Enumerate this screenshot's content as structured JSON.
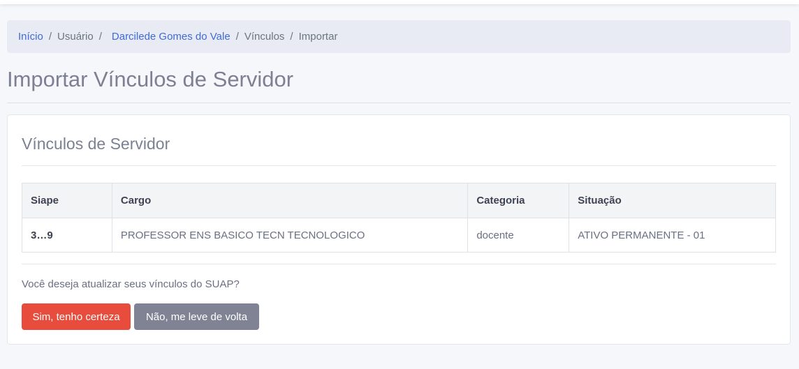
{
  "breadcrumb": {
    "home": "Início",
    "user": "Usuário",
    "person": "Darcilede Gomes do Vale",
    "links": "Vínculos",
    "current": "Importar",
    "separator": "/"
  },
  "page": {
    "title": "Importar Vínculos de Servidor"
  },
  "card": {
    "title": "Vínculos de Servidor",
    "table": {
      "headers": [
        "Siape",
        "Cargo",
        "Categoria",
        "Situação"
      ],
      "rows": [
        [
          "3…9",
          "PROFESSOR ENS BASICO TECN TECNOLOGICO",
          "docente",
          "ATIVO PERMANENTE - 01"
        ]
      ]
    },
    "question": "Você deseja atualizar seus vínculos do SUAP?",
    "confirm_label": "Sim, tenho certeza",
    "cancel_label": "Não, me leve de volta"
  },
  "colors": {
    "link": "#3f6ad8",
    "danger": "#e74c3c",
    "secondary": "#7f8394",
    "background": "#f6f7fb"
  }
}
